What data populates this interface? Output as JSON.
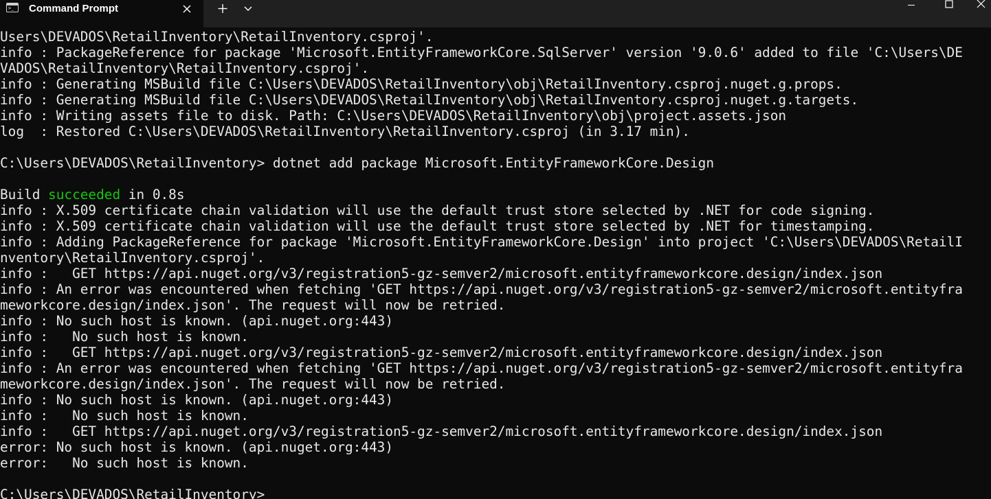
{
  "tab": {
    "icon": "terminal-icon",
    "title": "Command Prompt",
    "close_icon": "close-icon"
  },
  "tabbar": {
    "new_tab_icon": "plus-icon",
    "dropdown_icon": "chevron-down-icon"
  },
  "window_controls": {
    "minimize_icon": "minimize-icon",
    "maximize_icon": "maximize-icon",
    "close_icon": "close-icon"
  },
  "colors": {
    "background": "#0c0c0c",
    "titlebar": "#202020",
    "text": "#e8e8e8",
    "success_green": "#16c60c"
  },
  "terminal": {
    "lines": [
      "Users\\DEVADOS\\RetailInventory\\RetailInventory.csproj'.",
      "info : PackageReference for package 'Microsoft.EntityFrameworkCore.SqlServer' version '9.0.6' added to file 'C:\\Users\\DE",
      "VADOS\\RetailInventory\\RetailInventory.csproj'.",
      "info : Generating MSBuild file C:\\Users\\DEVADOS\\RetailInventory\\obj\\RetailInventory.csproj.nuget.g.props.",
      "info : Generating MSBuild file C:\\Users\\DEVADOS\\RetailInventory\\obj\\RetailInventory.csproj.nuget.g.targets.",
      "info : Writing assets file to disk. Path: C:\\Users\\DEVADOS\\RetailInventory\\obj\\project.assets.json",
      "log  : Restored C:\\Users\\DEVADOS\\RetailInventory\\RetailInventory.csproj (in 3.17 min).",
      "",
      "C:\\Users\\DEVADOS\\RetailInventory> dotnet add package Microsoft.EntityFrameworkCore.Design",
      "",
      "",
      "info : X.509 certificate chain validation will use the default trust store selected by .NET for code signing.",
      "info : X.509 certificate chain validation will use the default trust store selected by .NET for timestamping.",
      "info : Adding PackageReference for package 'Microsoft.EntityFrameworkCore.Design' into project 'C:\\Users\\DEVADOS\\RetailI",
      "nventory\\RetailInventory.csproj'.",
      "info :   GET https://api.nuget.org/v3/registration5-gz-semver2/microsoft.entityframeworkcore.design/index.json",
      "info : An error was encountered when fetching 'GET https://api.nuget.org/v3/registration5-gz-semver2/microsoft.entityfra",
      "meworkcore.design/index.json'. The request will now be retried.",
      "info : No such host is known. (api.nuget.org:443)",
      "info :   No such host is known.",
      "info :   GET https://api.nuget.org/v3/registration5-gz-semver2/microsoft.entityframeworkcore.design/index.json",
      "info : An error was encountered when fetching 'GET https://api.nuget.org/v3/registration5-gz-semver2/microsoft.entityfra",
      "meworkcore.design/index.json'. The request will now be retried.",
      "info : No such host is known. (api.nuget.org:443)",
      "info :   No such host is known.",
      "info :   GET https://api.nuget.org/v3/registration5-gz-semver2/microsoft.entityframeworkcore.design/index.json",
      "error: No such host is known. (api.nuget.org:443)",
      "error:   No such host is known.",
      "",
      "C:\\Users\\DEVADOS\\RetailInventory>"
    ],
    "build_line": {
      "prefix": "Build ",
      "status": "succeeded",
      "suffix": " in 0.8s"
    }
  }
}
